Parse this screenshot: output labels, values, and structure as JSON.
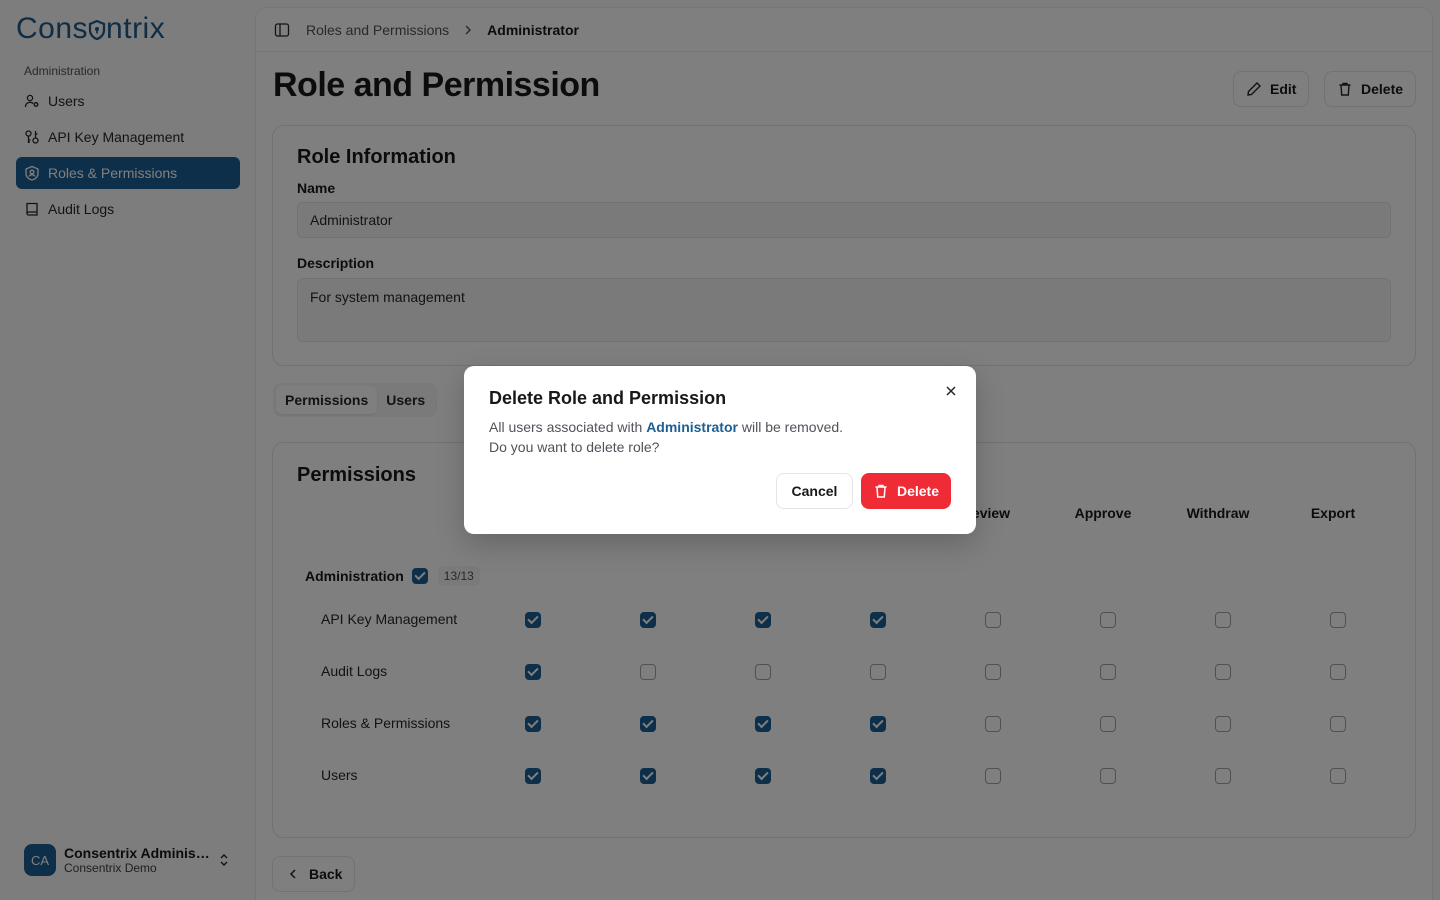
{
  "brand": {
    "name_before": "Cons",
    "name_after": "ntrix"
  },
  "sidebar": {
    "section_label": "Administration",
    "items": [
      {
        "label": "Users",
        "icon": "users-icon",
        "active": false
      },
      {
        "label": "API Key Management",
        "icon": "api-key-icon",
        "active": false
      },
      {
        "label": "Roles & Permissions",
        "icon": "shield-icon",
        "active": true
      },
      {
        "label": "Audit Logs",
        "icon": "book-icon",
        "active": false
      }
    ],
    "user": {
      "initials": "CA",
      "name": "Consentrix Administ...",
      "org": "Consentrix Demo"
    }
  },
  "breadcrumb": {
    "parent": "Roles and Permissions",
    "current": "Administrator"
  },
  "header": {
    "title": "Role and Permission",
    "edit_label": "Edit",
    "delete_label": "Delete"
  },
  "role_info": {
    "title": "Role Information",
    "name_label": "Name",
    "name_value": "Administrator",
    "description_label": "Description",
    "description_value": "For system management"
  },
  "tabs": [
    {
      "label": "Permissions",
      "active": true
    },
    {
      "label": "Users",
      "active": false
    }
  ],
  "permissions": {
    "title": "Permissions",
    "columns": [
      "",
      "",
      "",
      "",
      "Review",
      "Approve",
      "Withdraw",
      "Export"
    ],
    "visible_columns": [
      "eview",
      "Approve",
      "Withdraw",
      "Export"
    ],
    "group": {
      "label": "Administration",
      "checked": true,
      "count": "13/13"
    },
    "rows": [
      {
        "label": "API Key Management",
        "checks": [
          true,
          true,
          true,
          true,
          false,
          false,
          false,
          false
        ]
      },
      {
        "label": "Audit Logs",
        "checks": [
          true,
          false,
          false,
          false,
          false,
          false,
          false,
          false
        ]
      },
      {
        "label": "Roles & Permissions",
        "checks": [
          true,
          true,
          true,
          true,
          false,
          false,
          false,
          false
        ]
      },
      {
        "label": "Users",
        "checks": [
          true,
          true,
          true,
          true,
          false,
          false,
          false,
          false
        ]
      }
    ]
  },
  "back_label": "Back",
  "dialog": {
    "title": "Delete Role and Permission",
    "line1_before": "All users associated with ",
    "line1_highlight": "Administrator",
    "line1_after": " will be removed.",
    "line2": "Do you want to delete role?",
    "cancel_label": "Cancel",
    "delete_label": "Delete"
  },
  "colors": {
    "brand": "#1d5f92",
    "danger": "#ef2b35"
  }
}
